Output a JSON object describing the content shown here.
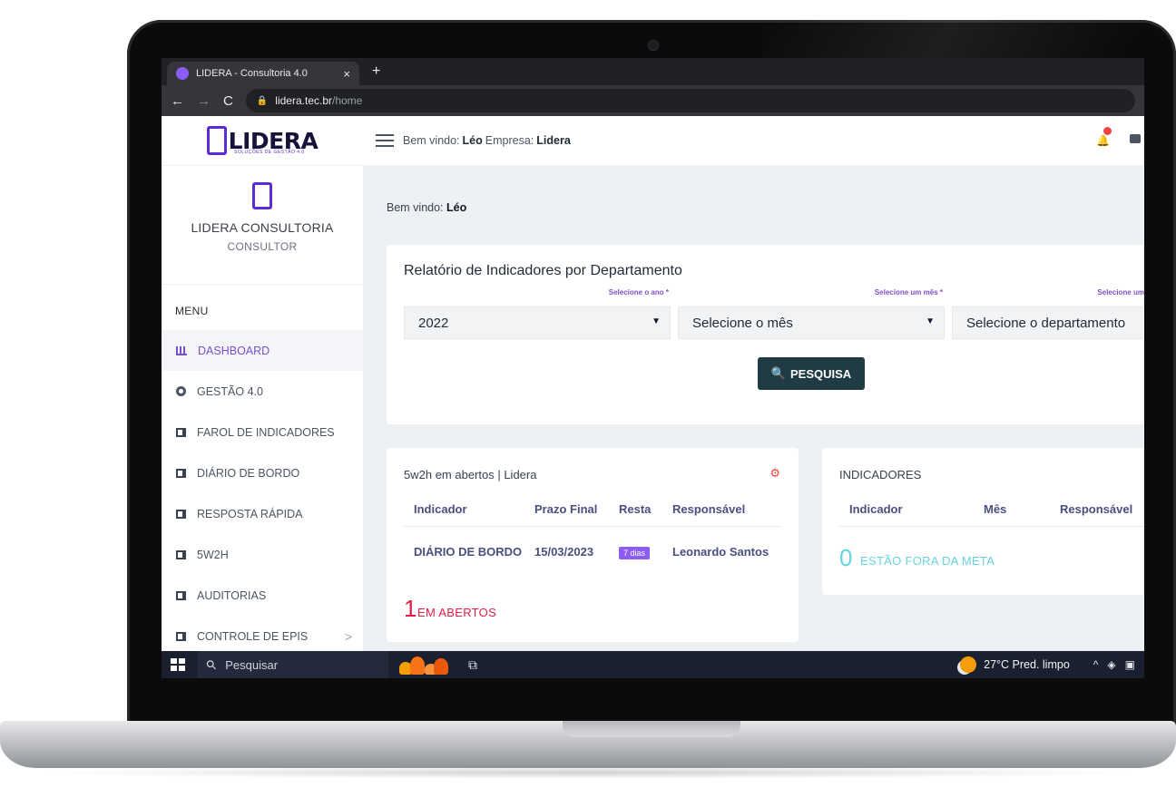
{
  "browser": {
    "tab_title": "LIDERA - Consultoria 4.0",
    "tab_close": "×",
    "new_tab": "+",
    "back": "←",
    "forward": "→",
    "reload": "C",
    "url_host": "lidera.tec.br",
    "url_path": "/home"
  },
  "brand": {
    "name": "LIDERA",
    "tagline": "SOLUÇÕES DE GESTÃO 4.0"
  },
  "profile": {
    "name": "LIDERA CONSULTORIA",
    "role": "CONSULTOR"
  },
  "menu": {
    "title": "MENU",
    "items": [
      {
        "label": "DASHBOARD",
        "icon": "bar-chart-icon",
        "active": true
      },
      {
        "label": "GESTÃO 4.0",
        "icon": "circle-icon"
      },
      {
        "label": "FAROL DE INDICADORES",
        "icon": "grid-icon"
      },
      {
        "label": "DIÁRIO DE BORDO",
        "icon": "grid-icon"
      },
      {
        "label": "RESPOSTA RÁPIDA",
        "icon": "grid-icon"
      },
      {
        "label": "5W2H",
        "icon": "grid-icon"
      },
      {
        "label": "AUDITORIAS",
        "icon": "grid-icon"
      },
      {
        "label": "CONTROLE DE EPIS",
        "icon": "grid-icon",
        "chevron": ">"
      }
    ]
  },
  "topbar": {
    "welcome_prefix": "Bem vindo:",
    "user": "Léo",
    "company_prefix": "Empresa:",
    "company": "Lidera"
  },
  "content": {
    "welcome_prefix": "Bem vindo:",
    "user": "Léo"
  },
  "report": {
    "title": "Relatório de Indicadores por Departamento",
    "year_label": "Selecione o ano *",
    "month_label": "Selecione um mês *",
    "dept_label": "Selecione um",
    "year_value": "2022",
    "month_value": "Selecione o mês",
    "dept_value": "Selecione o departamento",
    "search_label": "PESQUISA"
  },
  "w2h": {
    "title": "5w2h em abertos | Lidera",
    "headers": [
      "Indicador",
      "Prazo Final",
      "Resta",
      "Responsável"
    ],
    "row": {
      "indicador": "DIÁRIO DE BORDO",
      "prazo": "15/03/2023",
      "resta": "7 dias",
      "responsavel": "Leonardo Santos"
    },
    "count": "1",
    "count_label": "EM ABERTOS"
  },
  "indicadores": {
    "title": "INDICADORES",
    "headers": [
      "Indicador",
      "Mês",
      "Responsável"
    ],
    "count": "0",
    "count_label": "ESTÃO FORA DA META"
  },
  "taskbar": {
    "search_placeholder": "Pesquisar",
    "weather": "27°C  Pred. limpo",
    "tray": "^"
  },
  "colors": {
    "accent": "#7b50c7",
    "brand": "#5b2bd6",
    "button": "#1f3b44",
    "alert": "#e11d48",
    "info": "#67d3dc"
  }
}
